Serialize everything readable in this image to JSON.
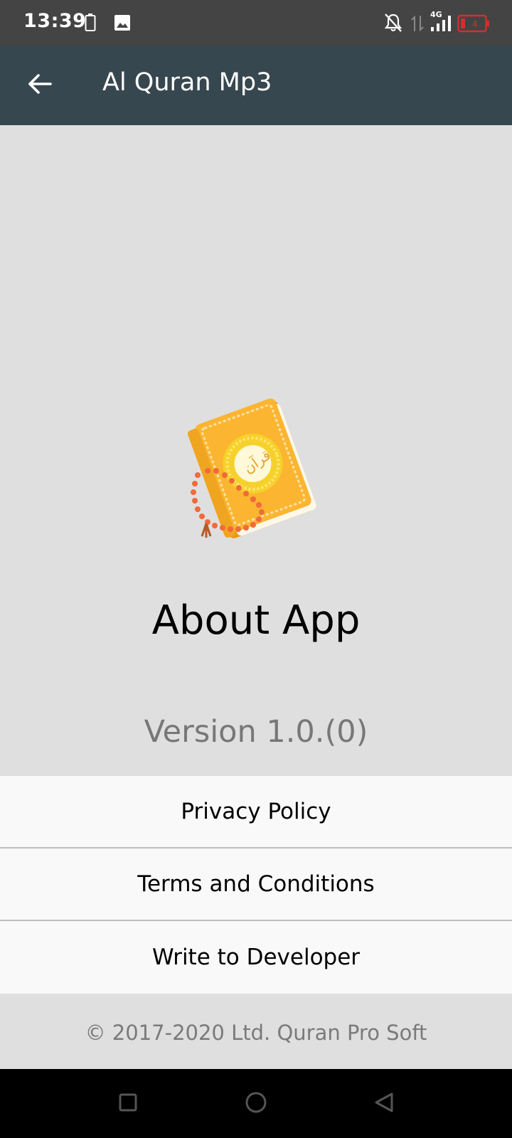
{
  "status_bar": {
    "time": "13:39",
    "icons": [
      "battery-outline-icon",
      "image-icon",
      "notifications-off-icon",
      "data-arrows-icon",
      "signal-4g-icon",
      "battery-low-icon"
    ],
    "network_label": "4G",
    "battery_color": "#d32f2f"
  },
  "app_bar": {
    "title": "Al Quran Mp3",
    "background": "#37474f"
  },
  "about": {
    "heading": "About App",
    "version": "Version 1.0.(0)"
  },
  "menu": {
    "items": [
      {
        "label": "Privacy Policy"
      },
      {
        "label": "Terms and Conditions"
      },
      {
        "label": "Write to Developer"
      }
    ]
  },
  "footer": {
    "copyright": "© 2017-2020 Ltd. Quran Pro Soft"
  },
  "navigation_bar": {
    "buttons": [
      "recents-square-icon",
      "home-circle-icon",
      "back-triangle-icon"
    ]
  }
}
